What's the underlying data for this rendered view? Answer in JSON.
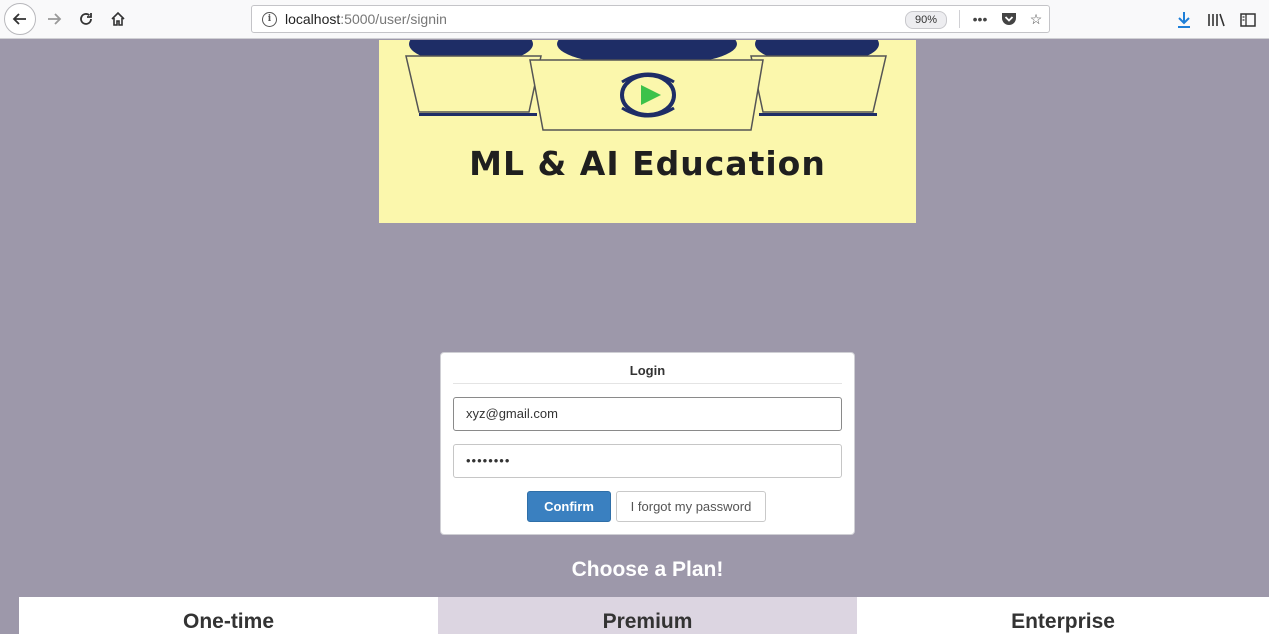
{
  "browser": {
    "url_host": "localhost",
    "url_path": ":5000/user/signin",
    "zoom": "90%"
  },
  "logo": {
    "text": "ML & AI Education"
  },
  "login": {
    "title": "Login",
    "email_value": "xyz@gmail.com",
    "password_value": "••••••••",
    "confirm_label": "Confirm",
    "forgot_label": "I forgot my password"
  },
  "plans": {
    "heading": "Choose a Plan!",
    "items": [
      {
        "name": "One-time"
      },
      {
        "name": "Premium"
      },
      {
        "name": "Enterprise"
      }
    ]
  }
}
